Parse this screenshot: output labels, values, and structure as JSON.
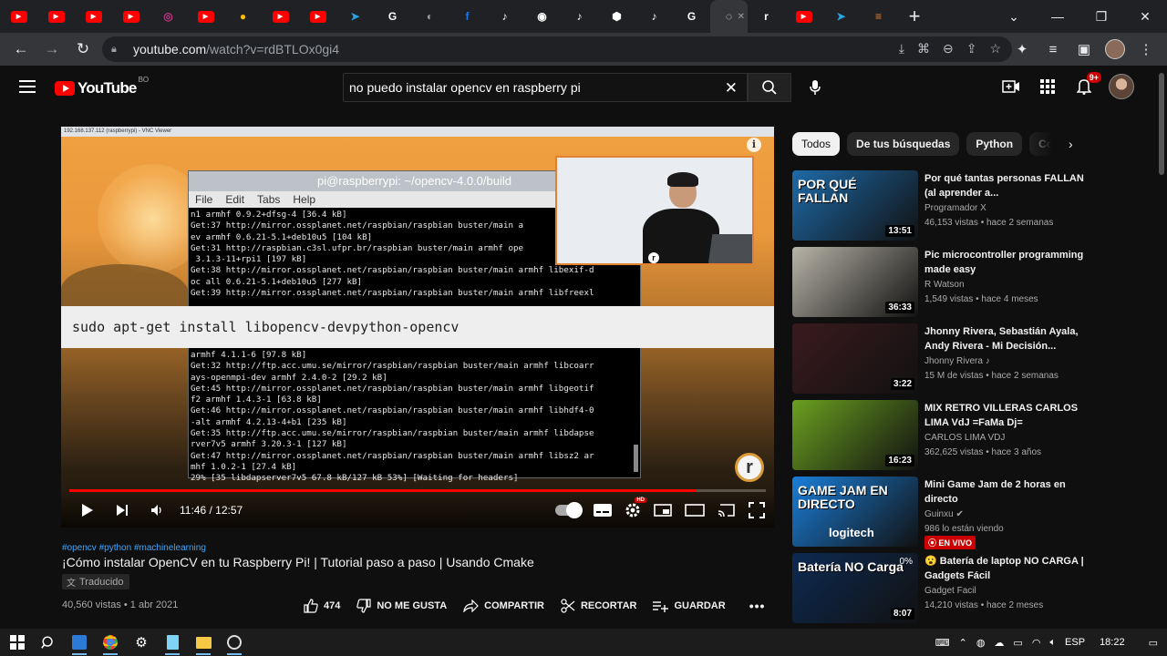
{
  "browser": {
    "tabs": [
      {
        "icon": "youtube-icon",
        "color": "#ff0000"
      },
      {
        "icon": "youtube-icon",
        "color": "#ff0000"
      },
      {
        "icon": "youtube-icon",
        "color": "#ff0000"
      },
      {
        "icon": "youtube-icon",
        "color": "#ff0000"
      },
      {
        "icon": "instagram-icon",
        "color": "#c13584"
      },
      {
        "icon": "youtube-icon",
        "color": "#ff0000"
      },
      {
        "icon": "chrome-web-icon",
        "color": "#fbbc05"
      },
      {
        "icon": "youtube-icon",
        "color": "#ff0000"
      },
      {
        "icon": "youtube-icon",
        "color": "#ff0000"
      },
      {
        "icon": "telegram-icon",
        "color": "#2aa3df"
      },
      {
        "icon": "google-icon",
        "color": "#ffffff"
      },
      {
        "icon": "globe-icon",
        "color": "#9aa0a6"
      },
      {
        "icon": "facebook-icon",
        "color": "#1877f2"
      },
      {
        "icon": "tiktok-icon",
        "color": "#ffffff"
      },
      {
        "icon": "github-icon",
        "color": "#ffffff"
      },
      {
        "icon": "tiktok-icon",
        "color": "#ffffff"
      },
      {
        "icon": "cube-icon",
        "color": "#ffffff"
      },
      {
        "icon": "tiktok-icon",
        "color": "#ffffff"
      },
      {
        "icon": "google-icon",
        "color": "#ffffff"
      },
      {
        "icon": "loading-icon",
        "color": "#e8eaed",
        "active": true
      },
      {
        "icon": "r-logo-icon",
        "color": "#ffffff"
      },
      {
        "icon": "youtube-icon",
        "color": "#ff0000"
      },
      {
        "icon": "telegram-icon",
        "color": "#2aa3df"
      },
      {
        "icon": "stackoverflow-icon",
        "color": "#f48024"
      }
    ],
    "url_host": "youtube.com",
    "url_path": "/watch?v=rdBTLOx0gi4"
  },
  "header": {
    "logo_text": "YouTube",
    "country_code": "BO",
    "search_value": "no puedo instalar opencv en raspberry pi",
    "notifications_badge": "9+"
  },
  "player": {
    "vnc_title": "192.168.137.112 (raspberrypi) - VNC Viewer",
    "terminal_title": "pi@raspberrypi: ~/opencv-4.0.0/build",
    "terminal_menu": [
      "File",
      "Edit",
      "Tabs",
      "Help"
    ],
    "terminal_top": "n1 armhf 0.9.2+dfsg-4 [36.4 kB]\nGet:37 http://mirror.ossplanet.net/raspbian/raspbian buster/main a\nev armhf 0.6.21-5.1+deb10u5 [104 kB]\nGet:31 http://raspbian.c3sl.ufpr.br/raspbian buster/main armhf ope\n 3.1.3-11+rpi1 [197 kB]\nGet:38 http://mirror.ossplanet.net/raspbian/raspbian buster/main armhf libexif-d\noc all 0.6.21-5.1+deb10u5 [277 kB]\nGet:39 http://mirror.ossplanet.net/raspbian/raspbian buster/main armhf libfreexl",
    "command": "sudo apt-get install libopencv-devpython-opencv",
    "terminal_bottom": "armhf 4.1.1-6 [97.8 kB]\nGet:32 http://ftp.acc.umu.se/mirror/raspbian/raspbian buster/main armhf libcoarr\nays-openmpi-dev armhf 2.4.0-2 [29.2 kB]\nGet:45 http://mirror.ossplanet.net/raspbian/raspbian buster/main armhf libgeotif\nf2 armhf 1.4.3-1 [63.8 kB]\nGet:46 http://mirror.ossplanet.net/raspbian/raspbian buster/main armhf libhdf4-0\n-alt armhf 4.2.13-4+b1 [235 kB]\nGet:35 http://ftp.acc.umu.se/mirror/raspbian/raspbian buster/main armhf libdapse\nrver7v5 armhf 3.20.3-1 [127 kB]\nGet:47 http://mirror.ossplanet.net/raspbian/raspbian buster/main armhf libsz2 ar\nmhf 1.0.2-1 [27.4 kB]\n29% [35 libdapserver7v5 67.8 kB/127 kB 53%] [Waiting for headers]",
    "watermark": "r",
    "time": "11:46 / 12:57",
    "progress_fraction": 0.9
  },
  "video": {
    "tags": "#opencv #python #machinelearning",
    "title": "¡Cómo instalar OpenCV en tu Raspberry Pi! | Tutorial paso a paso | Usando Cmake",
    "translated_label": "Traducido",
    "views_date": "40,560 vistas • 1 abr 2021",
    "likes": "474",
    "dislike_label": "NO ME GUSTA",
    "share_label": "COMPARTIR",
    "clip_label": "RECORTAR",
    "save_label": "GUARDAR"
  },
  "sidebar": {
    "chips": [
      "Todos",
      "De tus búsquedas",
      "Python",
      "Com"
    ],
    "recommendations": [
      {
        "title": "Por qué tantas personas FALLAN (al aprender a...",
        "channel": "Programador X",
        "meta": "46,153 vistas • hace 2 semanas",
        "duration": "13:51",
        "thumb_text": "POR QUÉ FALLAN",
        "thumb_color": "#1e6aa8"
      },
      {
        "title": "Pic microcontroller programming made easy",
        "channel": "R Watson",
        "meta": "1,549 vistas • hace 4 meses",
        "duration": "36:33",
        "thumb_text": "",
        "thumb_color": "#b8b4a8"
      },
      {
        "title": "Jhonny Rivera, Sebastián Ayala, Andy Rivera - Mi Decisión...",
        "channel": "Jhonny Rivera ♪",
        "meta": "15 M de vistas • hace 2 semanas",
        "duration": "3:22",
        "thumb_text": "",
        "thumb_color": "#3a1a1e"
      },
      {
        "title": "MIX RETRO VILLERAS CARLOS LIMA VdJ =FaMa Dj=",
        "channel": "CARLOS LIMA VDJ",
        "meta": "362,625 vistas • hace 3 años",
        "duration": "16:23",
        "thumb_text": "",
        "thumb_color": "#6aa020"
      },
      {
        "title": "Mini Game Jam de 2 horas en directo",
        "channel": "Guinxu ✔",
        "meta": "986 lo están viendo",
        "live": "EN VIVO",
        "thumb_text": "GAME JAM EN DIRECTO",
        "thumb_brand": "logitech",
        "thumb_color": "#1a7ed8"
      },
      {
        "title": "😮 Batería de laptop NO CARGA | Gadgets Fácil",
        "channel": "Gadget Facil",
        "meta": "14,210 vistas • hace 2 meses",
        "duration": "8:07",
        "thumb_text": "Batería NO Carga",
        "thumb_pct": "0%",
        "thumb_color": "#0d2a52"
      }
    ]
  },
  "taskbar": {
    "language": "ESP",
    "time": "18:22"
  }
}
